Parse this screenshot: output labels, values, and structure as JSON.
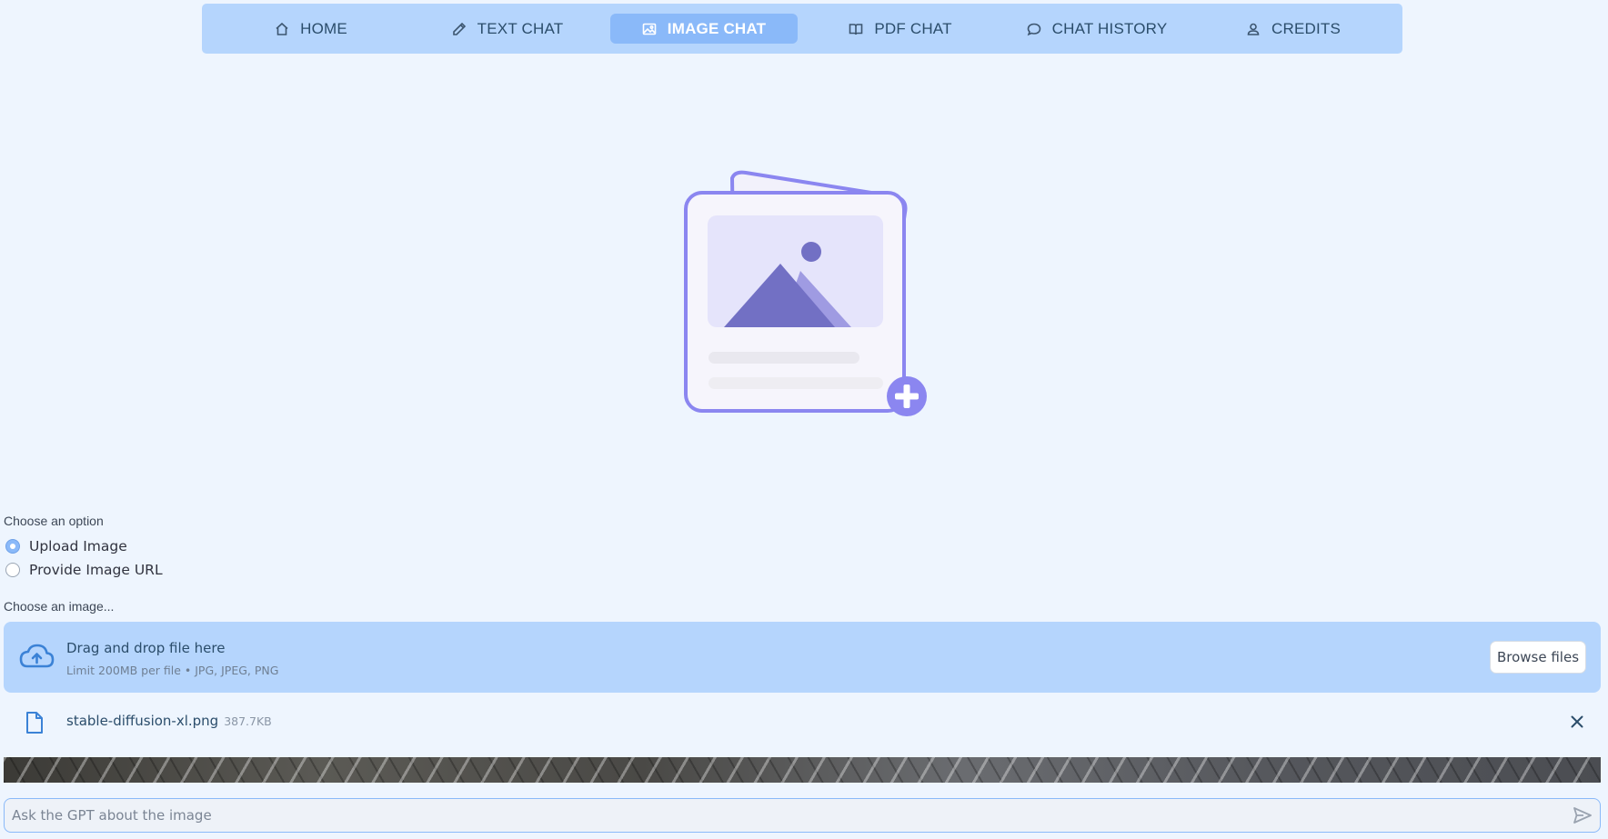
{
  "nav": {
    "items": [
      {
        "label": "HOME",
        "icon": "home-icon",
        "active": false
      },
      {
        "label": "TEXT CHAT",
        "icon": "pencil-icon",
        "active": false
      },
      {
        "label": "IMAGE CHAT",
        "icon": "image-icon",
        "active": true
      },
      {
        "label": "PDF CHAT",
        "icon": "book-icon",
        "active": false
      },
      {
        "label": "CHAT HISTORY",
        "icon": "chat-bubble-icon",
        "active": false
      },
      {
        "label": "CREDITS",
        "icon": "user-icon",
        "active": false
      }
    ]
  },
  "illustration": {
    "icon": "image-upload-illustration",
    "accent": "#8b86f0"
  },
  "options": {
    "label": "Choose an option",
    "items": [
      {
        "label": "Upload Image",
        "checked": true
      },
      {
        "label": "Provide Image URL",
        "checked": false
      }
    ]
  },
  "uploader": {
    "label": "Choose an image...",
    "title": "Drag and drop file here",
    "subtitle": "Limit 200MB per file • JPG, JPEG, PNG",
    "browse_label": "Browse files",
    "icon": "cloud-upload-icon"
  },
  "file": {
    "name": "stable-diffusion-xl.png",
    "size": "387.7KB",
    "icon": "file-icon"
  },
  "chat": {
    "placeholder": "Ask the GPT about the image",
    "send_icon": "send-icon"
  },
  "colors": {
    "background": "#eef5fe",
    "nav_bg": "#b5d5fd",
    "nav_active": "#8ab9f9",
    "primary": "#3b82d6"
  }
}
